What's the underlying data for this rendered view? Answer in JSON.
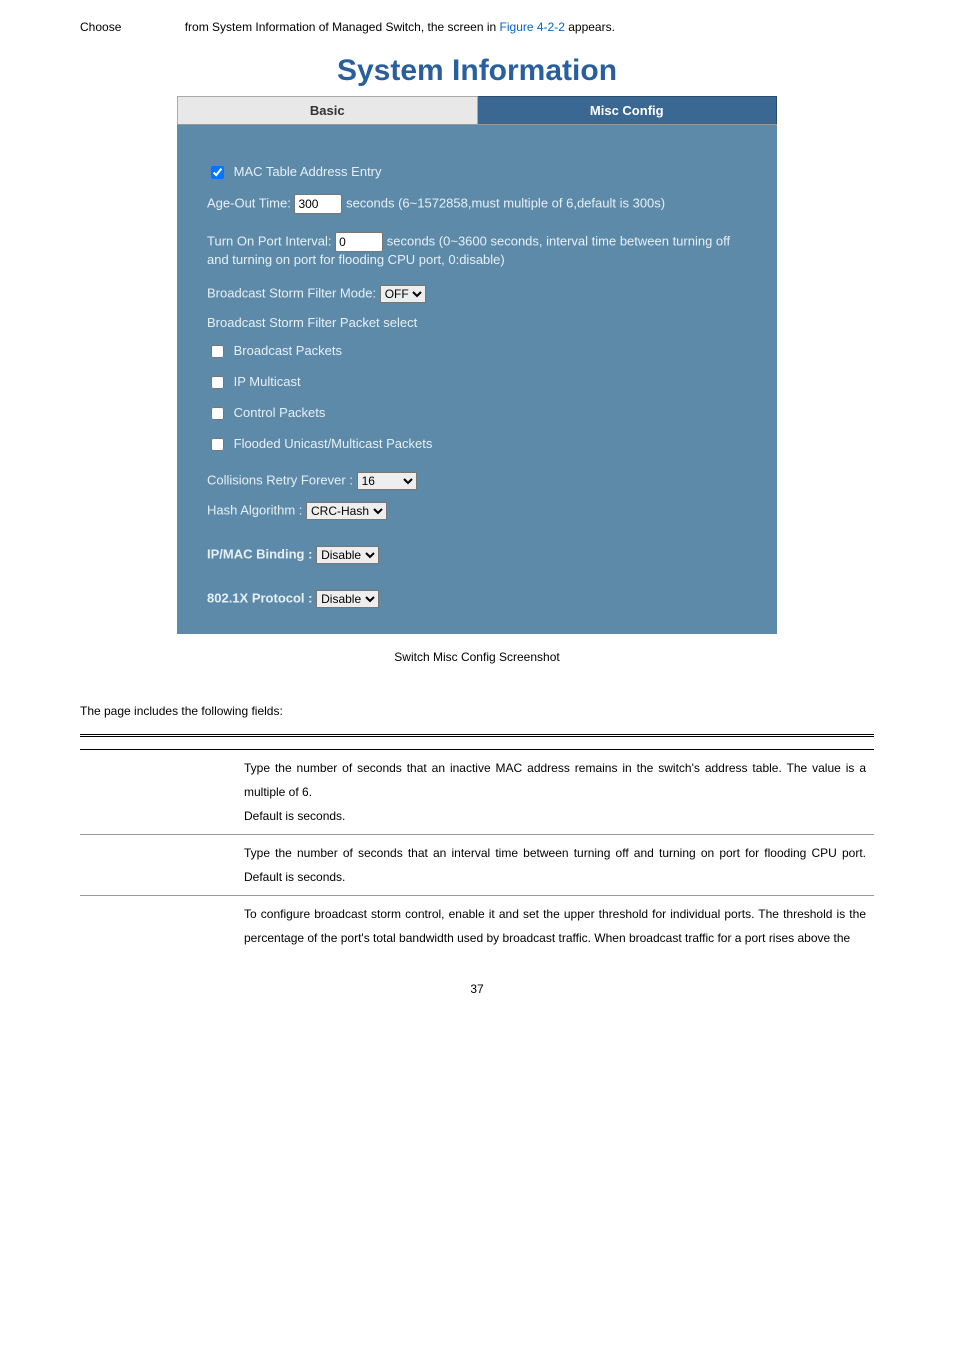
{
  "top": {
    "choose": "Choose",
    "rest_before_link": "from System Information of Managed Switch, the screen in ",
    "link": "Figure 4-2-2",
    "rest_after_link": " appears."
  },
  "panel": {
    "title": "System Information",
    "tabs": {
      "basic": "Basic",
      "misc": "Misc Config"
    },
    "mac_entry_label": "MAC Table Address Entry",
    "age_out_label": "Age-Out Time:",
    "age_out_value": "300",
    "age_out_suffix": "seconds (6~1572858,must multiple of 6,default is 300s)",
    "turn_on_label": "Turn On Port Interval:",
    "turn_on_value": "0",
    "turn_on_suffix": "seconds (0~3600 seconds, interval time between turning off and turning on port for flooding CPU port, 0:disable)",
    "storm_mode_label": "Broadcast Storm Filter Mode:",
    "storm_mode_value": "OFF",
    "storm_packet_select": "Broadcast Storm Filter Packet select",
    "cb_broadcast": "Broadcast Packets",
    "cb_ipmulticast": "IP Multicast",
    "cb_control": "Control Packets",
    "cb_flooded": "Flooded Unicast/Multicast Packets",
    "collisions_label": "Collisions Retry Forever :",
    "collisions_value": "16",
    "hash_label": "Hash Algorithm :",
    "hash_value": "CRC-Hash",
    "ipmac_label": "IP/MAC Binding :",
    "ipmac_value": "Disable",
    "dot1x_label": "802.1X Protocol :",
    "dot1x_value": "Disable"
  },
  "caption": "Switch Misc Config Screenshot",
  "intro": "The page includes the following fields:",
  "table": {
    "rows": [
      {
        "obj": "",
        "desc_parts": [
          "Type the number of seconds that an inactive MAC address remains in the switch's address table. The value is a multiple of 6.",
          "Default is      seconds."
        ]
      },
      {
        "obj": "",
        "desc_parts": [
          "Type the number of seconds that an interval time between turning off and turning on port for flooding CPU port. Default is    seconds."
        ]
      },
      {
        "obj": "",
        "desc_parts": [
          "To configure broadcast storm control, enable it and set the upper threshold for individual ports. The threshold is the percentage of the port's total bandwidth used by broadcast traffic. When broadcast traffic for a port rises above the"
        ]
      }
    ]
  },
  "page_num": "37"
}
